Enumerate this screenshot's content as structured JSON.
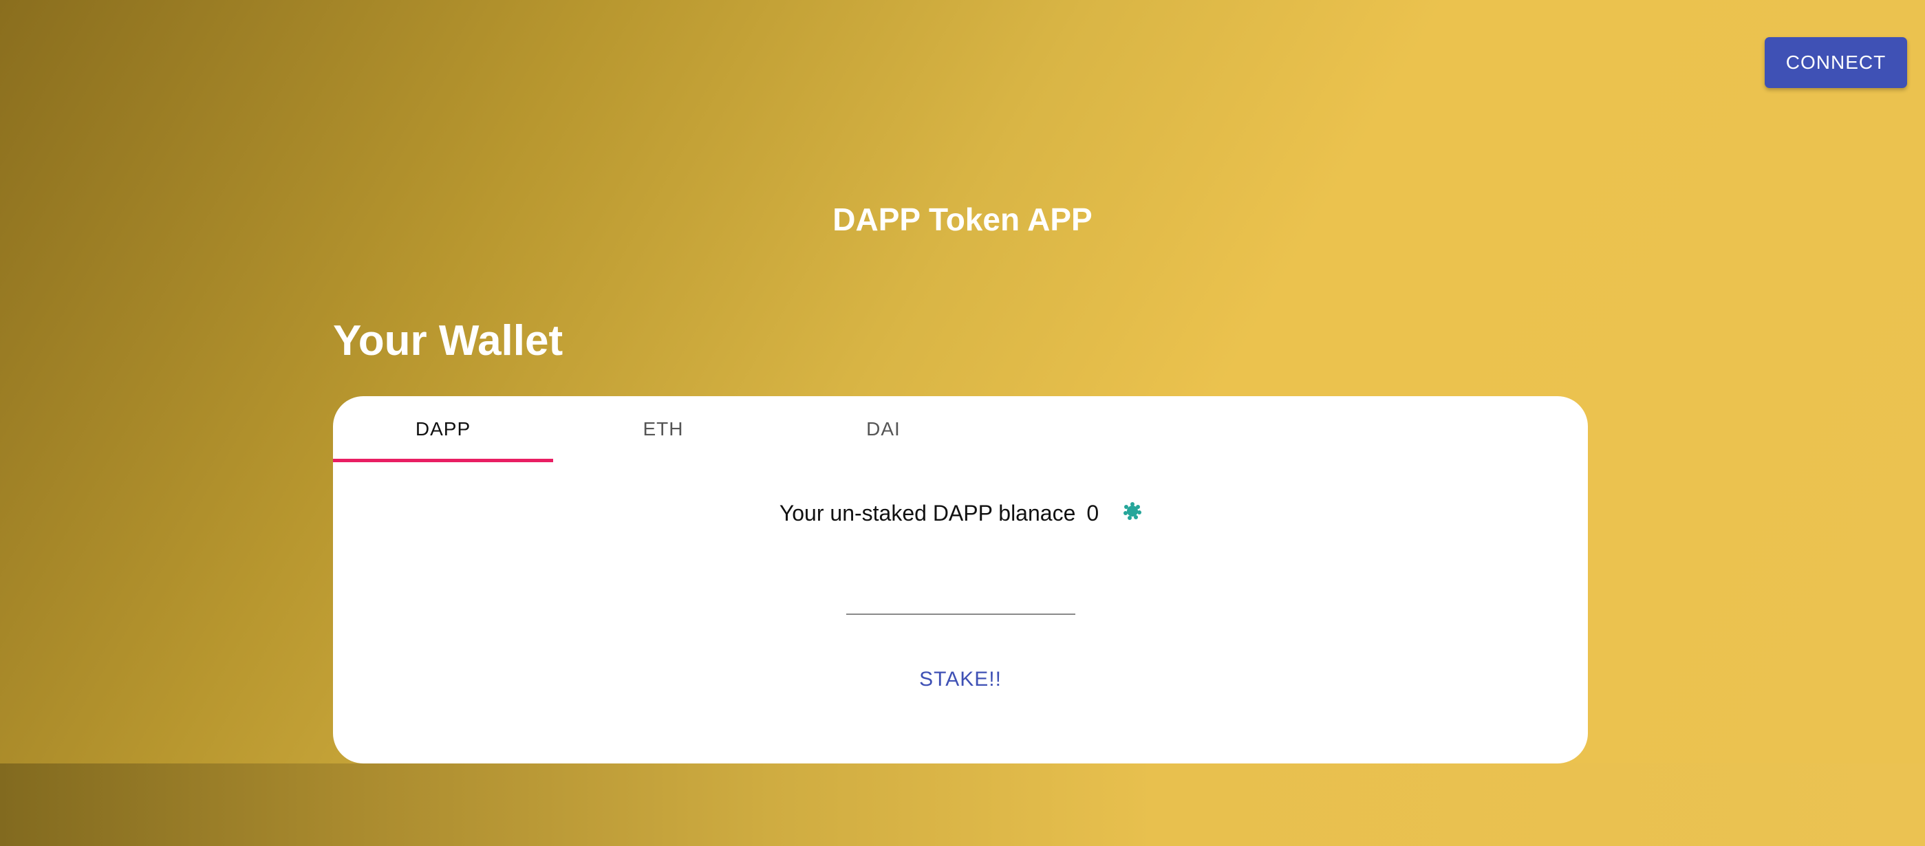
{
  "header": {
    "connect_label": "CONNECT",
    "app_title": "DAPP Token APP"
  },
  "wallet": {
    "title": "Your Wallet",
    "tabs": [
      {
        "label": "DAPP",
        "active": true
      },
      {
        "label": "ETH",
        "active": false
      },
      {
        "label": "DAI",
        "active": false
      }
    ],
    "balance_label": "Your un-staked DAPP blanace",
    "balance_value": "0",
    "stake_input": {
      "value": "",
      "placeholder": ""
    },
    "stake_label": "STAKE!!"
  },
  "icons": {
    "balance_indicator": "spinner-icon"
  },
  "colors": {
    "accent": "#3f51b5",
    "tab_indicator": "#e91e63",
    "spinner": "#26a69a",
    "background_dark": "#8a6e1e",
    "background_light": "#ebc24e"
  }
}
